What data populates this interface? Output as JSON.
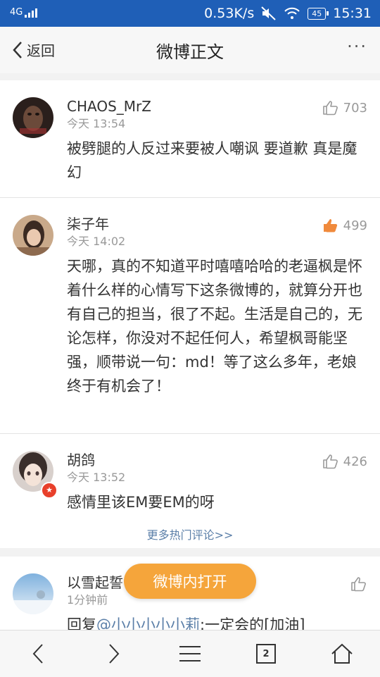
{
  "status_bar": {
    "network": "4G",
    "speed": "0.53K/s",
    "battery": "45",
    "time": "15:31"
  },
  "header": {
    "back_label": "返回",
    "title": "微博正文"
  },
  "comments": [
    {
      "name": "CHAOS_MrZ",
      "time": "今天 13:54",
      "likes": "703",
      "text": "被劈腿的人反过来要被人嘲讽 要道歉 真是魔幻"
    },
    {
      "name": "柒子年",
      "time": "今天 14:02",
      "likes": "499",
      "text": "天哪，真的不知道平时嘻嘻哈哈的老逼枫是怀着什么样的心情写下这条微博的，就算分开也有自己的担当，很了不起。生活是自己的，无论怎样，你没对不起任何人，希望枫哥能坚强，顺带说一句：md！等了这么多年，老娘终于有机会了！"
    },
    {
      "name": "胡鸽",
      "time": "今天 13:52",
      "likes": "426",
      "text": "感情里该EM要EM的呀"
    },
    {
      "name": "以雪起誓",
      "time": "1分钟前",
      "text_prefix": "回复",
      "mention": "@小小小小小莉",
      "text_suffix": ":一定会的[加油]"
    }
  ],
  "more_hot_comments": "更多热门评论>>",
  "open_in_app": "微博内打开",
  "bottom_nav": {
    "tab_count": "2"
  },
  "colors": {
    "status_bar": "#1f5fb7",
    "liked": "#f08a3c",
    "open_button": "#f5a53b",
    "link": "#5b7fa8"
  }
}
